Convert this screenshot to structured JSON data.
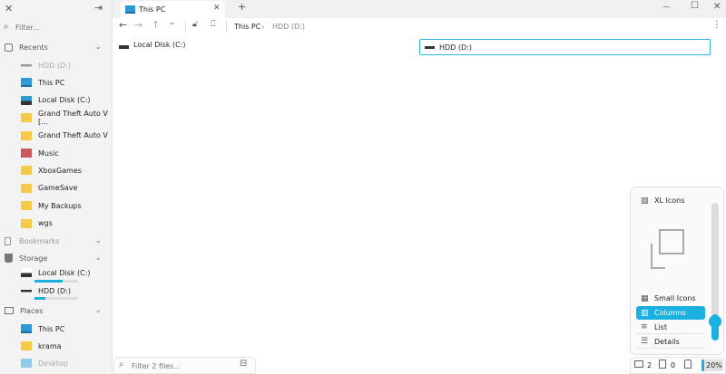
{
  "app": {
    "tab_title": "This PC"
  },
  "sidebar": {
    "filter_placeholder": "Filter...",
    "recents_label": "Recents",
    "recents": [
      {
        "label": "HDD (D:)",
        "icon": "hdd-icon",
        "dim": true
      },
      {
        "label": "This PC",
        "icon": "pc-icon"
      },
      {
        "label": "Local Disk (C:)",
        "icon": "disk-icon"
      },
      {
        "label": "Grand Theft Auto V [...",
        "icon": "folder-icon"
      },
      {
        "label": "Grand Theft Auto V",
        "icon": "folder-icon"
      },
      {
        "label": "Music",
        "icon": "music-folder-icon"
      },
      {
        "label": "XboxGames",
        "icon": "folder-icon"
      },
      {
        "label": "GameSave",
        "icon": "folder-icon"
      },
      {
        "label": "My Backups",
        "icon": "folder-icon"
      },
      {
        "label": "wgs",
        "icon": "folder-icon"
      }
    ],
    "bookmarks_label": "Bookmarks",
    "storage_label": "Storage",
    "storage": [
      {
        "label": "Local Disk (C:)",
        "used_percent": 65
      },
      {
        "label": "HDD (D:)",
        "used_percent": 25
      }
    ],
    "places_label": "Places",
    "places": [
      {
        "label": "This PC"
      },
      {
        "label": "krama"
      },
      {
        "label": "Desktop"
      }
    ]
  },
  "breadcrumb": [
    "This PC",
    "HDD (D:)"
  ],
  "main": {
    "items": [
      {
        "label": "Local Disk (C:)",
        "selected": false
      },
      {
        "label": "HDD (D:)",
        "selected": true
      }
    ]
  },
  "filter": {
    "placeholder": "Filter 2 files..."
  },
  "view_menu": {
    "xl": "XL Icons",
    "small": "Small Icons",
    "columns": "Columns",
    "list": "List",
    "details": "Details",
    "selected": "Columns"
  },
  "status": {
    "folders": "2",
    "files": "0",
    "zoom": "20%"
  },
  "colors": {
    "accent": "#1ab0e0"
  }
}
